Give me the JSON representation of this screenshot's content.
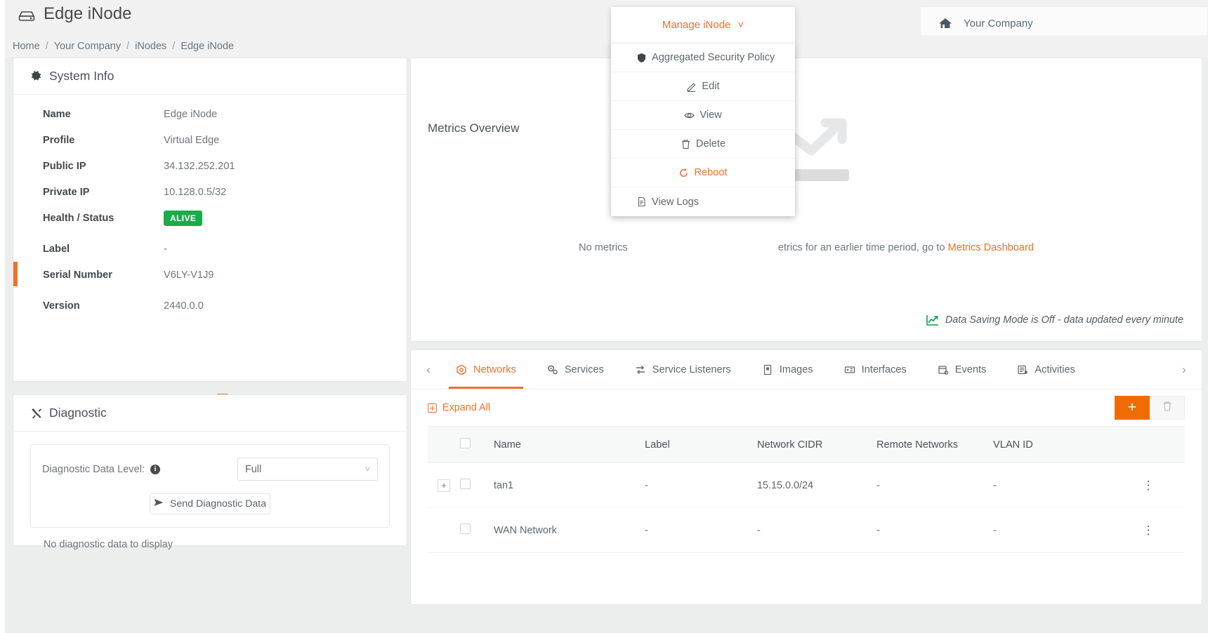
{
  "header": {
    "title": "Edge iNode",
    "title_icon": "hdd-icon",
    "company": "Your Company",
    "company_icon": "home-icon"
  },
  "breadcrumb": {
    "items": [
      "Home",
      "Your Company",
      "iNodes",
      "Edge iNode"
    ],
    "separator": "/"
  },
  "system_info": {
    "title": "System Info",
    "icon": "gear-icon",
    "rows": [
      {
        "key": "Name",
        "value": "Edge iNode"
      },
      {
        "key": "Profile",
        "value": "Virtual Edge"
      },
      {
        "key": "Public IP",
        "value": "34.132.252.201"
      },
      {
        "key": "Private IP",
        "value": "10.128.0.5/32"
      },
      {
        "key": "Health / Status",
        "value": "ALIVE",
        "type": "badge",
        "badge_color": "#1aab4b"
      },
      {
        "key": "Label",
        "value": "-"
      },
      {
        "key": "Serial Number",
        "value": "V6LY-V1J9"
      },
      {
        "key": "Version",
        "value": "2440.0.0"
      }
    ],
    "expand_caret": "caret-down-icon"
  },
  "diagnostic": {
    "title": "Diagnostic",
    "icon": "tools-icon",
    "level_label": "Diagnostic Data Level:",
    "info_icon": "info-icon",
    "level_value": "Full",
    "level_options": [
      "Full"
    ],
    "send_button": "Send Diagnostic Data",
    "send_icon": "send-icon",
    "empty_text": "No diagnostic data to display"
  },
  "metrics": {
    "title": "Metrics Overview",
    "empty_message_prefix": "No metrics",
    "empty_message_suffix": "etrics for an earlier time period, go to",
    "empty_link": "Metrics Dashboard",
    "saving_mode": "Data Saving Mode is Off - data updated every minute",
    "saving_icon": "chart-up-icon"
  },
  "manage_menu": {
    "header_label": "Manage iNode",
    "header_icon": "chevron-down-icon",
    "items": [
      {
        "label": "Aggregated Security Policy",
        "icon": "shield-icon",
        "danger": false
      },
      {
        "label": "Edit",
        "icon": "pencil-icon",
        "danger": false
      },
      {
        "label": "View",
        "icon": "eye-icon",
        "danger": false
      },
      {
        "label": "Delete",
        "icon": "trash-icon",
        "danger": false
      },
      {
        "label": "Reboot",
        "icon": "refresh-icon",
        "danger": true
      },
      {
        "label": "View Logs",
        "icon": "file-text-icon",
        "danger": false
      }
    ]
  },
  "bottom": {
    "prev_arrow": "chevron-left-icon",
    "next_arrow": "chevron-right-icon",
    "tabs": [
      {
        "label": "Networks",
        "icon": "network-icon",
        "active": true
      },
      {
        "label": "Services",
        "icon": "services-icon",
        "active": false
      },
      {
        "label": "Service Listeners",
        "icon": "exchange-icon",
        "active": false
      },
      {
        "label": "Images",
        "icon": "image-icon",
        "active": false
      },
      {
        "label": "Interfaces",
        "icon": "interface-icon",
        "active": false
      },
      {
        "label": "Events",
        "icon": "events-icon",
        "active": false
      },
      {
        "label": "Activities",
        "icon": "activities-icon",
        "active": false
      }
    ],
    "expand_all": "Expand All",
    "add_button": "+",
    "delete_button": "delete-icon",
    "table": {
      "columns": [
        "Name",
        "Label",
        "Network CIDR",
        "Remote Networks",
        "VLAN ID"
      ],
      "rows": [
        {
          "expandable": true,
          "name": "tan1",
          "label": "-",
          "cidr": "15.15.0.0/24",
          "remote": "-",
          "vlan": "-"
        },
        {
          "expandable": false,
          "name": "WAN Network",
          "label": "-",
          "cidr": "-",
          "remote": "-",
          "vlan": "-"
        }
      ]
    }
  },
  "colors": {
    "accent": "#f0702a",
    "accent_solid": "#ef6c00",
    "alive": "#1aab4b",
    "page_bg": "#eceded",
    "text": "#5f676d"
  }
}
